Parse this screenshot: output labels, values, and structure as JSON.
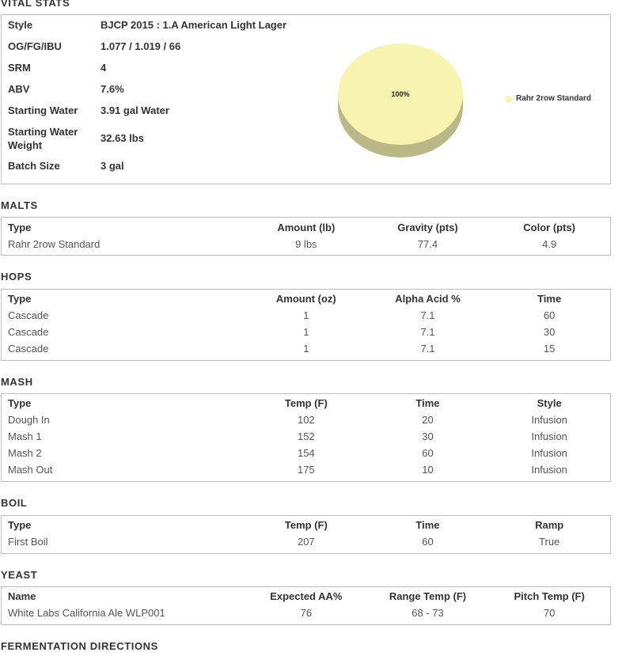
{
  "vital_stats": {
    "title": "VITAL STATS",
    "rows": [
      {
        "label": "Style",
        "value": "BJCP 2015 : 1.A American Light Lager"
      },
      {
        "label": "OG/FG/IBU",
        "value": "1.077 / 1.019 / 66"
      },
      {
        "label": "SRM",
        "value": "4"
      },
      {
        "label": "ABV",
        "value": "7.6%"
      },
      {
        "label": "Starting Water",
        "value": "3.91 gal Water"
      },
      {
        "label": "Starting Water Weight",
        "value": "32.63 lbs"
      },
      {
        "label": "Batch Size",
        "value": "3 gal"
      }
    ]
  },
  "chart_data": {
    "type": "pie",
    "slices": [
      {
        "label": "Rahr 2row Standard",
        "value": 100,
        "display": "100%",
        "color": "#f7f4b0"
      }
    ],
    "side_color": "#bbb888",
    "legend_position": "right"
  },
  "malts": {
    "title": "MALTS",
    "headers": [
      "Type",
      "Amount (lb)",
      "Gravity (pts)",
      "Color (pts)"
    ],
    "rows": [
      [
        "Rahr 2row Standard",
        "9 lbs",
        "77.4",
        "4.9"
      ]
    ]
  },
  "hops": {
    "title": "HOPS",
    "headers": [
      "Type",
      "Amount (oz)",
      "Alpha Acid %",
      "Time"
    ],
    "rows": [
      [
        "Cascade",
        "1",
        "7.1",
        "60"
      ],
      [
        "Cascade",
        "1",
        "7.1",
        "30"
      ],
      [
        "Cascade",
        "1",
        "7.1",
        "15"
      ]
    ]
  },
  "mash": {
    "title": "MASH",
    "headers": [
      "Type",
      "Temp (F)",
      "Time",
      "Style"
    ],
    "rows": [
      [
        "Dough In",
        "102",
        "20",
        "Infusion"
      ],
      [
        "Mash 1",
        "152",
        "30",
        "Infusion"
      ],
      [
        "Mash 2",
        "154",
        "60",
        "Infusion"
      ],
      [
        "Mash Out",
        "175",
        "10",
        "Infusion"
      ]
    ]
  },
  "boil": {
    "title": "BOIL",
    "headers": [
      "Type",
      "Temp (F)",
      "Time",
      "Ramp"
    ],
    "rows": [
      [
        "First Boil",
        "207",
        "60",
        "True"
      ]
    ]
  },
  "yeast": {
    "title": "YEAST",
    "headers": [
      "Name",
      "Expected AA%",
      "Range Temp (F)",
      "Pitch Temp (F)"
    ],
    "rows": [
      [
        "White Labs California Ale WLP001",
        "76",
        "68 - 73",
        "70"
      ]
    ]
  },
  "fermentation": {
    "title": "FERMENTATION DIRECTIONS"
  }
}
